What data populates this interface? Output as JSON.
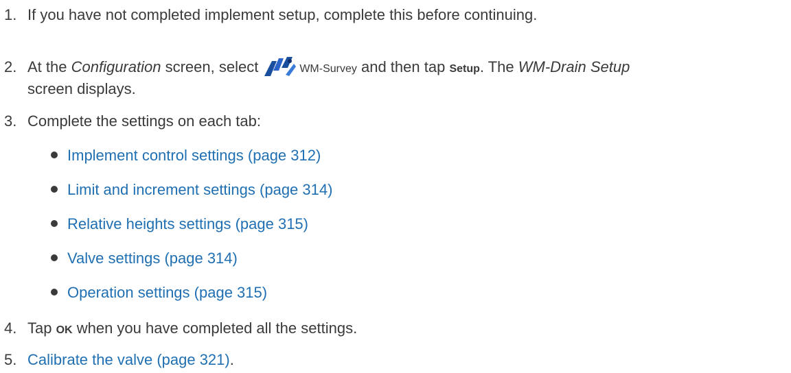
{
  "steps": {
    "s1": {
      "num": "1.",
      "text": "If you have not completed implement setup, complete this before continuing."
    },
    "s2": {
      "num": "2.",
      "a": "At the ",
      "screen_name": "Configuration",
      "b": " screen, select",
      "app_name": "WM-Survey",
      "c": " and then tap ",
      "button": "Setup",
      "d": ". The ",
      "setup_screen": "WM-Drain Setup",
      "e": "screen displays."
    },
    "s3": {
      "num": "3.",
      "text": "Complete the settings on each tab:"
    },
    "s4": {
      "num": "4.",
      "a": "Tap ",
      "ok": "OK",
      "b": " when you have completed all the settings."
    },
    "s5": {
      "num": "5.",
      "link": "Calibrate the valve (page 321)",
      "after": "."
    }
  },
  "tab_links": [
    "Implement control settings (page 312)",
    "Limit and increment settings (page 314)",
    "Relative heights settings (page 315)",
    "Valve settings (page 314)",
    "Operation settings (page 315)"
  ],
  "colors": {
    "text": "#3a3a3a",
    "link": "#1f6fb2",
    "icon": "#1a4fa0"
  },
  "icons": {
    "app_icon": "wm-survey-app-icon"
  }
}
